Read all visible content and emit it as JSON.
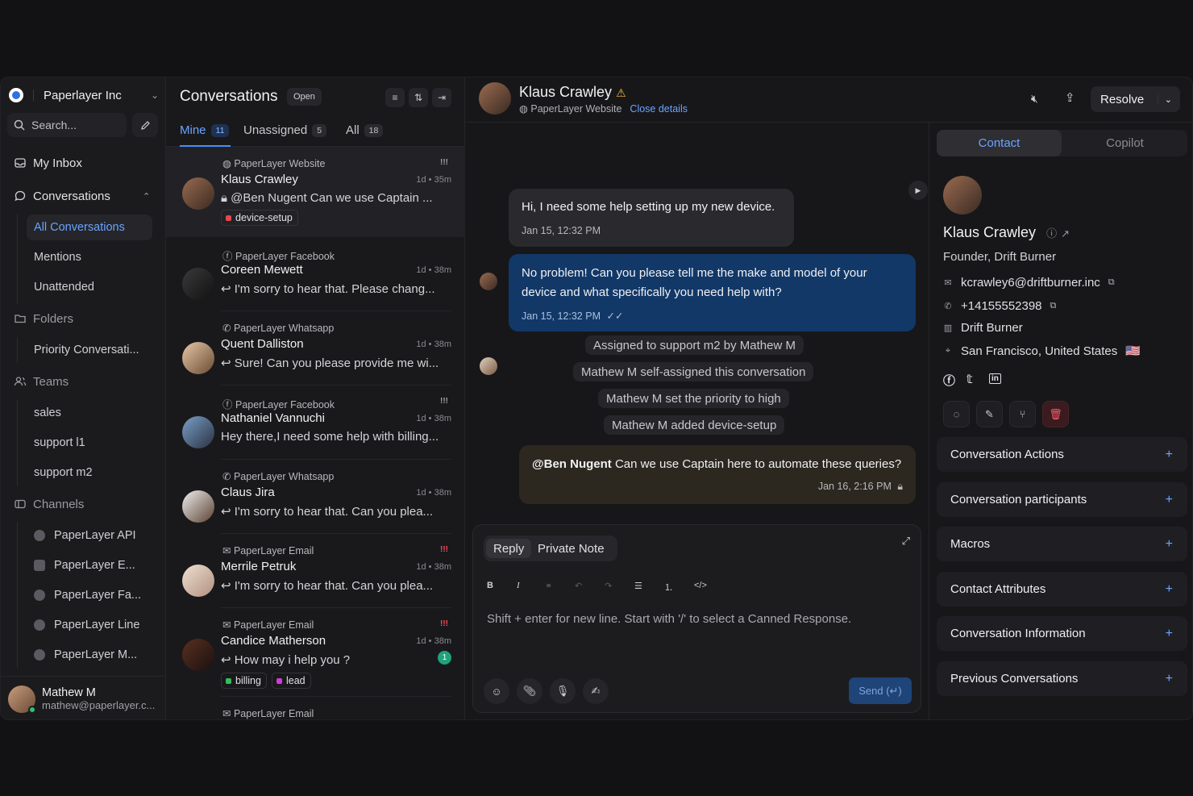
{
  "org": {
    "name": "Paperlayer Inc"
  },
  "search": {
    "placeholder": "Search..."
  },
  "nav": {
    "my_inbox": "My Inbox",
    "conversations": "Conversations",
    "conv_items": [
      "All Conversations",
      "Mentions",
      "Unattended"
    ],
    "folders": "Folders",
    "folder_items": [
      "Priority Conversati..."
    ],
    "teams": "Teams",
    "team_items": [
      "sales",
      "support l1",
      "support m2"
    ],
    "channels": "Channels",
    "channel_items": [
      "PaperLayer API",
      "PaperLayer E...",
      "PaperLayer Fa...",
      "PaperLayer Line",
      "PaperLayer M..."
    ]
  },
  "user": {
    "name": "Mathew M",
    "email": "mathew@paperlayer.c..."
  },
  "list": {
    "title": "Conversations",
    "status": "Open",
    "tabs": [
      {
        "label": "Mine",
        "count": "11"
      },
      {
        "label": "Unassigned",
        "count": "5"
      },
      {
        "label": "All",
        "count": "18"
      }
    ],
    "items": [
      {
        "source": "PaperLayer Website",
        "name": "Klaus Crawley",
        "time": "1d • 35m",
        "message": "@Ben Nugent Can we use Captain ...",
        "labels": [
          "device-setup"
        ],
        "priority": "!!!"
      },
      {
        "source": "PaperLayer Facebook",
        "name": "Coreen Mewett",
        "time": "1d • 38m",
        "message": "I'm sorry to hear that. Please chang...",
        "labels": [],
        "priority": ""
      },
      {
        "source": "PaperLayer Whatsapp",
        "name": "Quent Dalliston",
        "time": "1d • 38m",
        "message": "Sure! Can you please provide me wi...",
        "labels": [],
        "priority": ""
      },
      {
        "source": "PaperLayer Facebook",
        "name": "Nathaniel Vannuchi",
        "time": "1d • 38m",
        "message": "Hey there,I need some help with billing...",
        "labels": [],
        "priority": "!!!"
      },
      {
        "source": "PaperLayer Whatsapp",
        "name": "Claus Jira",
        "time": "1d • 38m",
        "message": "I'm sorry to hear that. Can you plea...",
        "labels": [],
        "priority": ""
      },
      {
        "source": "PaperLayer Email",
        "name": "Merrile Petruk",
        "time": "1d • 38m",
        "message": "I'm sorry to hear that. Can you plea...",
        "labels": [],
        "priority": "!!!"
      },
      {
        "source": "PaperLayer Email",
        "name": "Candice Matherson",
        "time": "1d • 38m",
        "message": "How may i help you ?",
        "labels": [
          "billing",
          "lead"
        ],
        "priority": "!!!",
        "unread": "1"
      },
      {
        "source": "PaperLayer Email",
        "name": "",
        "time": "",
        "message": "",
        "labels": [],
        "priority": ""
      }
    ]
  },
  "chat": {
    "contact_name": "Klaus Crawley",
    "source": "PaperLayer Website",
    "close_details": "Close details",
    "resolve": "Resolve",
    "messages": [
      {
        "text": "Hi, I need some help setting up my new device.",
        "time": "Jan 15, 12:32 PM"
      },
      {
        "text_line1": "No problem! Can you please tell me the make and model of your",
        "text_line2": "device and what specifically you need help with?",
        "time": "Jan 15, 12:32 PM"
      }
    ],
    "activities": [
      "Assigned to support m2 by Mathew M",
      "Mathew M self-assigned this conversation",
      "Mathew M set the priority to high",
      "Mathew M added device-setup"
    ],
    "note": {
      "mention": "@Ben Nugent",
      "text": " Can we use Captain here to automate these queries?",
      "time": "Jan 16, 2:16 PM"
    },
    "reply": {
      "reply_label": "Reply",
      "note_label": "Private Note",
      "placeholder": "Shift + enter for new line. Start with '/' to select a Canned Response.",
      "send": "Send (↵)"
    }
  },
  "panel": {
    "tabs": [
      "Contact",
      "Copilot"
    ],
    "name": "Klaus Crawley",
    "role": "Founder, Drift Burner",
    "email": "kcrawley6@driftburner.inc",
    "phone": "+14155552398",
    "company": "Drift Burner",
    "location": "San Francisco, United States",
    "flag": "🇺🇸",
    "sections": [
      "Conversation Actions",
      "Conversation participants",
      "Macros",
      "Contact Attributes",
      "Conversation Information",
      "Previous Conversations"
    ]
  },
  "colors": {
    "accent": "#6aa4ff",
    "outgoing_bubble": "#123868",
    "urgent": "#ff4b5a"
  }
}
